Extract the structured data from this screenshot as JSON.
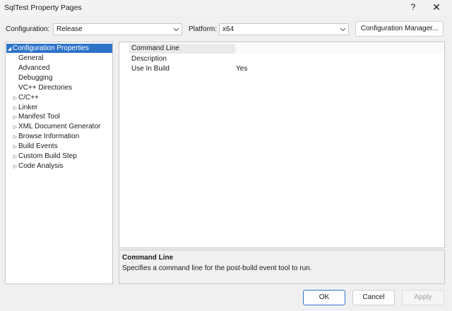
{
  "window": {
    "title": "SqlTest Property Pages",
    "help_label": "?",
    "close_label": "✕"
  },
  "config": {
    "configuration_label": "Configuration:",
    "configuration_value": "Release",
    "platform_label": "Platform:",
    "platform_value": "x64",
    "manager_button": "Configuration Manager..."
  },
  "tree": {
    "root": {
      "label": "Configuration Properties",
      "expanded": true
    },
    "children": [
      {
        "label": "General",
        "expandable": false
      },
      {
        "label": "Advanced",
        "expandable": false
      },
      {
        "label": "Debugging",
        "expandable": false
      },
      {
        "label": "VC++ Directories",
        "expandable": false
      },
      {
        "label": "C/C++",
        "expandable": true
      },
      {
        "label": "Linker",
        "expandable": true
      },
      {
        "label": "Manifest Tool",
        "expandable": true
      },
      {
        "label": "XML Document Generator",
        "expandable": true
      },
      {
        "label": "Browse Information",
        "expandable": true
      },
      {
        "label": "Build Events",
        "expandable": true
      },
      {
        "label": "Custom Build Step",
        "expandable": true
      },
      {
        "label": "Code Analysis",
        "expandable": true
      }
    ]
  },
  "grid": {
    "rows": [
      {
        "name": "Command Line",
        "value": ""
      },
      {
        "name": "Description",
        "value": ""
      },
      {
        "name": "Use In Build",
        "value": "Yes"
      }
    ]
  },
  "description": {
    "title": "Command Line",
    "text": "Specifies a command line for the post-build event tool to run."
  },
  "buttons": {
    "ok": "OK",
    "cancel": "Cancel",
    "apply": "Apply"
  },
  "colors": {
    "accent": "#2f73c9",
    "selected_row": "#eaeaea",
    "disabled_text": "#a0a0a0"
  }
}
